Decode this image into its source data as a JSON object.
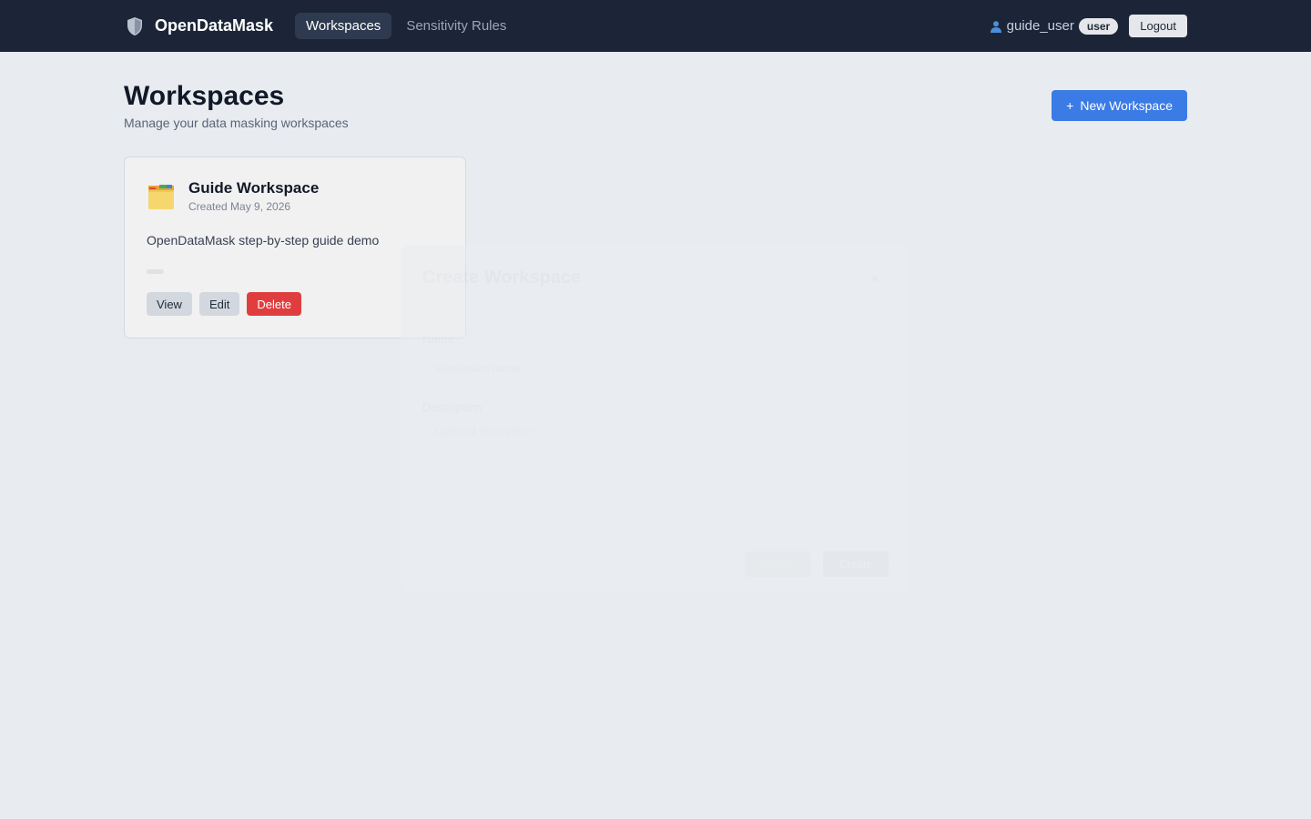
{
  "nav": {
    "brand": "OpenDataMask",
    "links": [
      {
        "label": "Workspaces",
        "active": true
      },
      {
        "label": "Sensitivity Rules",
        "active": false
      }
    ],
    "user": "guide_user",
    "role": "user",
    "logout": "Logout",
    "brand_icon": "shield-icon",
    "user_icon": "user-icon"
  },
  "page": {
    "title": "Workspaces",
    "subtitle": "Manage your data masking workspaces",
    "new_button": "New Workspace",
    "new_button_icon": "+"
  },
  "workspaces": [
    {
      "name": "Guide Workspace",
      "created": "Created May 9, 2026",
      "description": "OpenDataMask step-by-step guide demo",
      "icon": "folder-icon",
      "actions": {
        "view": "View",
        "edit": "Edit",
        "delete": "Delete"
      }
    }
  ],
  "modal": {
    "title": "Create Workspace",
    "close": "×",
    "name_label": "Name",
    "name_placeholder": "Workspace name",
    "description_label": "Description",
    "description_placeholder": "Optional description",
    "cancel": "Cancel",
    "create": "Create"
  },
  "colors": {
    "navbar": "#1c2537",
    "primary": "#3b7be6",
    "danger": "#e03e3e",
    "background": "#e8ecf0"
  }
}
